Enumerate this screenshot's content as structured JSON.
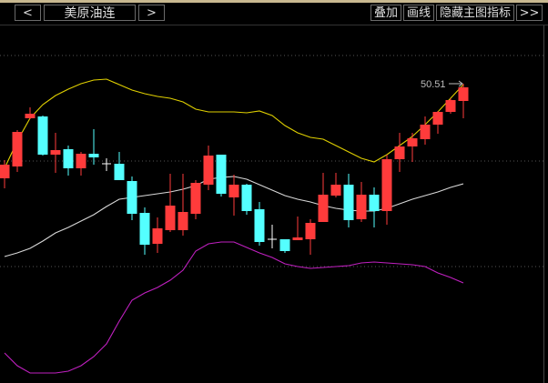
{
  "toolbar": {
    "prev_label": "<",
    "symbol": "美原油连",
    "next_label": ">",
    "overlay_label": "叠加",
    "draw_label": "画线",
    "hide_indicator_label": "隐藏主图指标",
    "more_label": ">>"
  },
  "colors": {
    "up": "#ff3b3b",
    "down": "#54ffff",
    "doji": "#ffffff",
    "upper": "#e0d000",
    "mid": "#d8d8d8",
    "lower": "#c020c0",
    "grid": "#555555",
    "bg": "#000000"
  },
  "chart_data": {
    "type": "candlestick",
    "max_label": "50.51",
    "ohlc": [
      [
        40.11,
        42.11,
        39.01,
        41.61
      ],
      [
        41.41,
        45.41,
        40.81,
        45.21
      ],
      [
        46.71,
        47.91,
        46.61,
        47.21
      ],
      [
        46.91,
        47.01,
        42.61,
        42.71
      ],
      [
        42.71,
        45.11,
        40.71,
        43.21
      ],
      [
        43.31,
        43.71,
        40.41,
        41.21
      ],
      [
        41.21,
        43.01,
        40.41,
        42.81
      ],
      [
        42.81,
        45.51,
        41.61,
        42.41
      ],
      [
        41.71,
        42.31,
        40.91,
        41.71
      ],
      [
        41.71,
        43.01,
        39.91,
        39.91
      ],
      [
        39.81,
        40.31,
        35.51,
        36.21
      ],
      [
        36.31,
        36.91,
        31.71,
        32.81
      ],
      [
        32.91,
        35.81,
        31.91,
        34.61
      ],
      [
        34.41,
        40.61,
        34.21,
        37.11
      ],
      [
        34.41,
        40.61,
        33.81,
        36.41
      ],
      [
        36.21,
        39.91,
        35.61,
        39.61
      ],
      [
        39.41,
        43.71,
        38.81,
        42.61
      ],
      [
        42.71,
        42.71,
        38.11,
        38.41
      ],
      [
        38.01,
        40.51,
        36.01,
        39.41
      ],
      [
        39.41,
        39.51,
        36.11,
        36.51
      ],
      [
        36.71,
        37.51,
        32.71,
        33.11
      ],
      [
        33.41,
        35.01,
        32.41,
        33.41
      ],
      [
        33.41,
        33.41,
        31.91,
        32.11
      ],
      [
        33.31,
        35.91,
        33.31,
        33.61
      ],
      [
        33.41,
        35.61,
        31.71,
        35.21
      ],
      [
        35.31,
        40.71,
        35.31,
        38.31
      ],
      [
        38.21,
        40.71,
        38.01,
        39.41
      ],
      [
        39.41,
        40.61,
        34.71,
        35.51
      ],
      [
        35.61,
        39.71,
        35.31,
        38.31
      ],
      [
        38.31,
        39.11,
        34.71,
        36.51
      ],
      [
        36.51,
        42.71,
        35.01,
        42.21
      ],
      [
        42.21,
        45.11,
        40.81,
        43.61
      ],
      [
        43.61,
        45.11,
        41.91,
        44.51
      ],
      [
        44.41,
        46.91,
        43.81,
        46.01
      ],
      [
        46.01,
        47.51,
        45.01,
        47.41
      ],
      [
        47.41,
        48.91,
        47.21,
        48.71
      ],
      [
        48.61,
        50.51,
        46.71,
        50.11
      ]
    ],
    "upper": [
      41.21,
      44.21,
      46.71,
      48.21,
      49.21,
      49.91,
      50.51,
      50.91,
      51.01,
      50.41,
      49.81,
      49.41,
      49.11,
      48.91,
      48.51,
      47.71,
      47.41,
      47.41,
      47.41,
      47.31,
      47.51,
      47.01,
      45.91,
      45.11,
      44.61,
      44.41,
      43.71,
      43.01,
      42.31,
      41.91,
      42.71,
      43.71,
      44.71,
      46.01,
      47.41,
      48.91,
      50.41
    ],
    "mid": [
      31.51,
      31.91,
      32.41,
      33.21,
      34.11,
      34.71,
      35.41,
      36.11,
      37.01,
      37.81,
      38.01,
      38.21,
      38.41,
      38.61,
      38.91,
      39.31,
      40.01,
      40.21,
      40.31,
      40.01,
      39.41,
      38.81,
      38.21,
      37.81,
      37.51,
      37.11,
      36.81,
      36.61,
      36.51,
      36.51,
      36.81,
      37.31,
      37.81,
      38.21,
      38.61,
      39.11,
      39.51
    ],
    "lower": [
      20.91,
      19.51,
      18.71,
      18.71,
      18.71,
      18.91,
      19.51,
      20.51,
      21.91,
      24.41,
      26.71,
      27.51,
      28.11,
      28.91,
      30.01,
      32.11,
      32.91,
      33.11,
      33.11,
      32.51,
      31.91,
      31.41,
      30.71,
      30.41,
      30.21,
      30.31,
      30.41,
      30.51,
      30.81,
      30.91,
      30.81,
      30.71,
      30.61,
      30.41,
      29.71,
      29.21,
      28.61
    ],
    "grid_levels": [
      53.61,
      42.01,
      30.41
    ]
  }
}
